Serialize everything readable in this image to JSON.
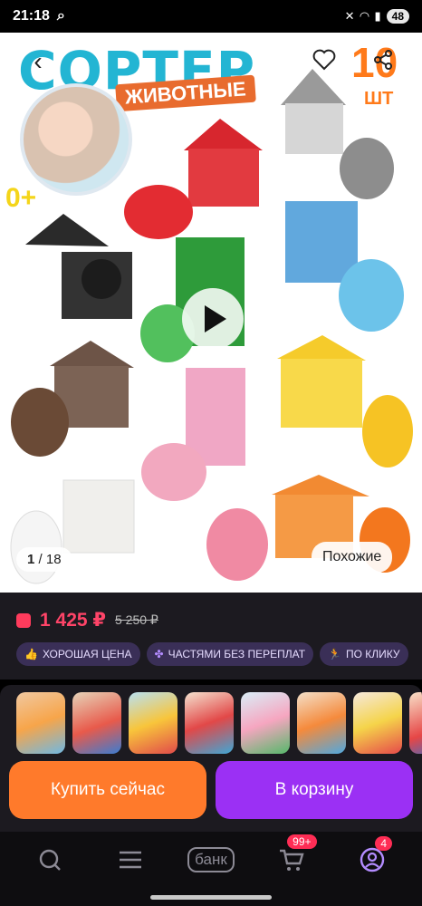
{
  "status_bar": {
    "time": "21:18",
    "battery": "48"
  },
  "hero": {
    "title": "СОРТЕР",
    "subtitle": "ЖИВОТНЫЕ",
    "count": "10",
    "count_unit": "ШТ",
    "age": "0+",
    "pager_current": "1",
    "pager_total": "/ 18",
    "similar_label": "Похожие"
  },
  "price": {
    "current": "1 425 ₽",
    "old": "5 250 ₽"
  },
  "chips": [
    {
      "label": "ХОРОШАЯ ЦЕНА"
    },
    {
      "label": "ЧАСТЯМИ БЕЗ ПЕРЕПЛАТ"
    },
    {
      "label": "ПО КЛИКУ"
    }
  ],
  "actions": {
    "buy": "Купить сейчас",
    "cart": "В корзину"
  },
  "nav": {
    "bank": "банк",
    "cart_badge": "99+",
    "profile_badge": "4"
  }
}
